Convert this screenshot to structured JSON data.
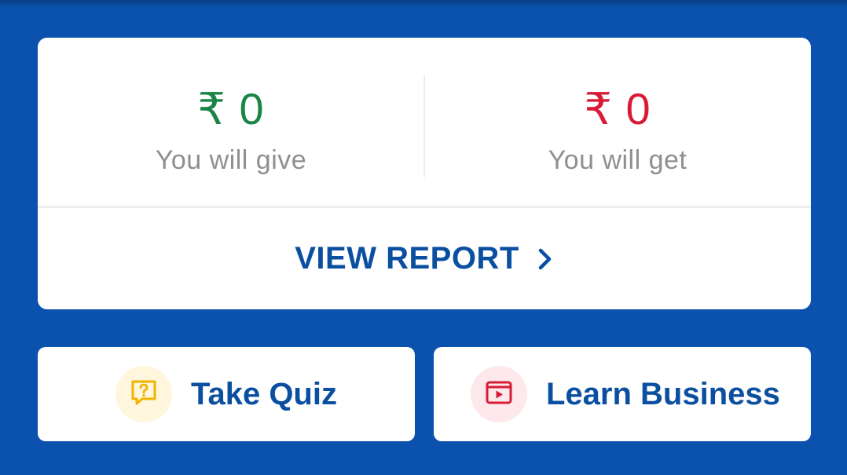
{
  "colors": {
    "background": "#0a52ae",
    "card": "#ffffff",
    "give": "#1b8446",
    "get": "#d91b36",
    "accent_text": "#0b4fa1",
    "muted_text": "#8f8f8f",
    "quiz_icon": "#f2b300",
    "learn_icon": "#d91b36"
  },
  "summary": {
    "give": {
      "amount": "₹ 0",
      "label": "You will give"
    },
    "get": {
      "amount": "₹ 0",
      "label": "You will get"
    },
    "view_report_label": "VIEW REPORT",
    "view_report_icon": "chevron-right-icon"
  },
  "actions": {
    "quiz": {
      "label": "Take Quiz",
      "icon": "quiz-question-icon"
    },
    "learn": {
      "label": "Learn Business",
      "icon": "video-play-icon"
    }
  }
}
